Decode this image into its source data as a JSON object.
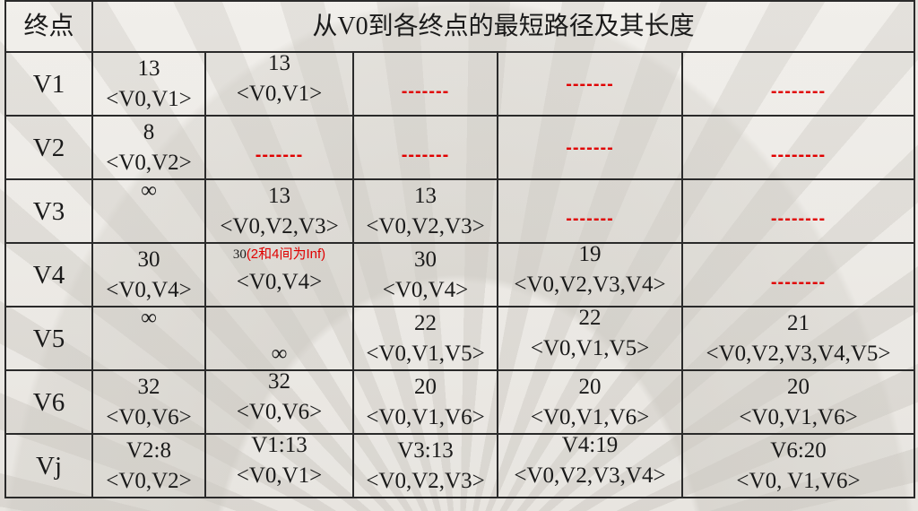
{
  "header": {
    "col_label": "终点",
    "title": "从V0到各终点的最短路径及其长度"
  },
  "rows": [
    {
      "label": "V1",
      "cells": [
        {
          "len": "13",
          "path": "<V0,V1>"
        },
        {
          "len": "13",
          "path": "<V0,V1>"
        },
        {
          "dash": "-------"
        },
        {
          "dash": "-------"
        },
        {
          "dash": "--------"
        }
      ]
    },
    {
      "label": "V2",
      "cells": [
        {
          "len": "8",
          "path": "<V0,V2>"
        },
        {
          "dash": "-------"
        },
        {
          "dash": "-------"
        },
        {
          "dash": "-------"
        },
        {
          "dash": "--------"
        }
      ]
    },
    {
      "label": "V3",
      "cells": [
        {
          "len": "∞",
          "path": ""
        },
        {
          "len": "13",
          "path": "<V0,V2,V3>"
        },
        {
          "len": "13",
          "path": "<V0,V2,V3>"
        },
        {
          "dash": "-------"
        },
        {
          "dash": "--------"
        }
      ]
    },
    {
      "label": "V4",
      "cells": [
        {
          "len": "30",
          "path": "<V0,V4>"
        },
        {
          "note_num": "30",
          "note_red": "(2和4间为Inf)",
          "path": "<V0,V4>"
        },
        {
          "len": "30",
          "path": "<V0,V4>"
        },
        {
          "len": "19",
          "path": "<V0,V2,V3,V4>"
        },
        {
          "dash": "--------"
        }
      ]
    },
    {
      "label": "V5",
      "cells": [
        {
          "len": "∞",
          "path": ""
        },
        {
          "len": "",
          "path": "∞"
        },
        {
          "len": "22",
          "path": "<V0,V1,V5>"
        },
        {
          "len": "22",
          "path": "<V0,V1,V5>"
        },
        {
          "len": "21",
          "path": "<V0,V2,V3,V4,V5>"
        }
      ]
    },
    {
      "label": "V6",
      "cells": [
        {
          "len": "32",
          "path": "<V0,V6>"
        },
        {
          "len": "32",
          "path": "<V0,V6>"
        },
        {
          "len": "20",
          "path": "<V0,V1,V6>"
        },
        {
          "len": "20",
          "path": "<V0,V1,V6>"
        },
        {
          "len": "20",
          "path": "<V0,V1,V6>"
        }
      ]
    },
    {
      "label": "Vj",
      "cells": [
        {
          "len": "V2:8",
          "path": "<V0,V2>"
        },
        {
          "len": "V1:13",
          "path": "<V0,V1>"
        },
        {
          "len": "V3:13",
          "path": "<V0,V2,V3>"
        },
        {
          "len": "V4:19",
          "path": "<V0,V2,V3,V4>"
        },
        {
          "len": "V6:20",
          "path": "<V0, V1,V6>"
        }
      ]
    }
  ]
}
